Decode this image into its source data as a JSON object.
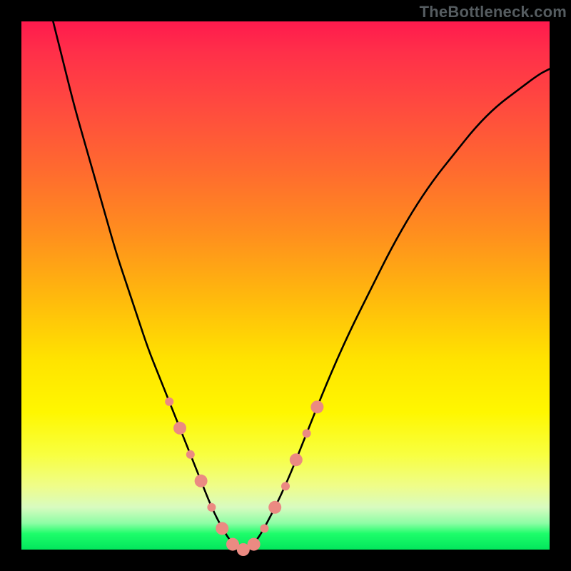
{
  "watermark": {
    "text": "TheBottleneck.com"
  },
  "chart_data": {
    "type": "line",
    "title": "",
    "xlabel": "",
    "ylabel": "",
    "xlim": [
      0,
      100
    ],
    "ylim": [
      0,
      100
    ],
    "series": [
      {
        "name": "bottleneck-curve",
        "x": [
          6,
          8,
          10,
          12,
          14,
          16,
          18,
          20,
          22,
          24,
          26,
          28,
          30,
          32,
          34,
          36,
          38,
          40,
          42,
          44,
          46,
          50,
          54,
          58,
          62,
          66,
          70,
          74,
          78,
          82,
          86,
          90,
          94,
          98,
          100
        ],
        "y": [
          100,
          92,
          84,
          77,
          70,
          63,
          56,
          50,
          44,
          38,
          33,
          28,
          23,
          18,
          13,
          8,
          4,
          1,
          0,
          1,
          4,
          12,
          22,
          32,
          41,
          49,
          57,
          64,
          70,
          75,
          80,
          84,
          87,
          90,
          91
        ]
      }
    ],
    "markers": {
      "name": "highlighted-points",
      "color": "#eb8a82",
      "radius_small": 6,
      "radius_large": 9,
      "points": [
        {
          "x": 28,
          "y": 28,
          "r": "small"
        },
        {
          "x": 30,
          "y": 23,
          "r": "large"
        },
        {
          "x": 32,
          "y": 18,
          "r": "small"
        },
        {
          "x": 34,
          "y": 13,
          "r": "large"
        },
        {
          "x": 36,
          "y": 8,
          "r": "small"
        },
        {
          "x": 38,
          "y": 4,
          "r": "large"
        },
        {
          "x": 40,
          "y": 1,
          "r": "large"
        },
        {
          "x": 42,
          "y": 0,
          "r": "large"
        },
        {
          "x": 44,
          "y": 1,
          "r": "large"
        },
        {
          "x": 46,
          "y": 4,
          "r": "small"
        },
        {
          "x": 48,
          "y": 8,
          "r": "large"
        },
        {
          "x": 50,
          "y": 12,
          "r": "small"
        },
        {
          "x": 52,
          "y": 17,
          "r": "large"
        },
        {
          "x": 54,
          "y": 22,
          "r": "small"
        },
        {
          "x": 56,
          "y": 27,
          "r": "large"
        }
      ]
    }
  }
}
